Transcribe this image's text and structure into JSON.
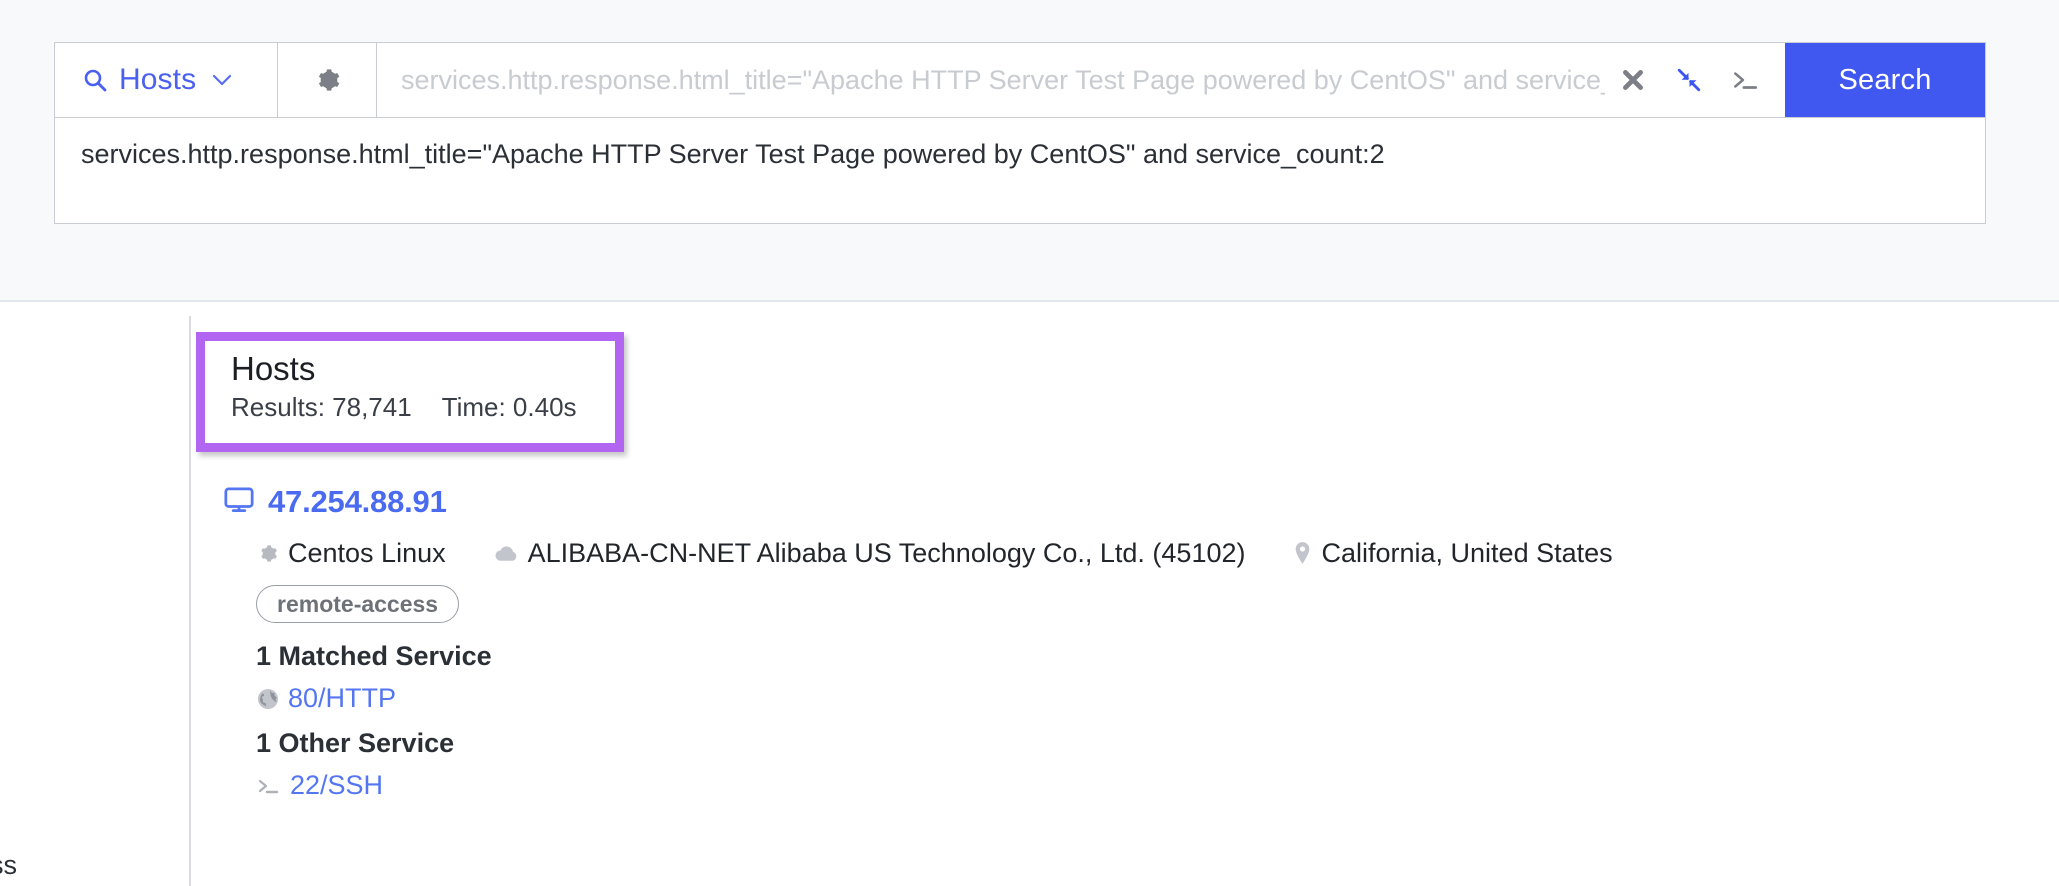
{
  "search": {
    "resource_type": "Hosts",
    "resource_icon": "search-icon",
    "settings_icon": "gear-icon",
    "query_value": "",
    "query_placeholder": "services.http.response.html_title=\"Apache HTTP Server Test Page powered by CentOS\" and service_count:2",
    "clear_icon": "close-x-icon",
    "collapse_icon": "collapse-arrows-icon",
    "console_icon": "terminal-prompt-icon",
    "submit_label": "Search",
    "suggestion": "services.http.response.html_title=\"Apache HTTP Server Test Page powered by CentOS\" and service_count:2",
    "accent_color": "#4057f0"
  },
  "results": {
    "facet_remnant_text": "ss",
    "summary": {
      "title": "Hosts",
      "results_label": "Results: 78,741",
      "time_label": "Time: 0.40s",
      "highlight_color": "#b265f0"
    },
    "hosts": [
      {
        "ip": "47.254.88.91",
        "host_icon": "monitor-icon",
        "os": "Centos Linux",
        "os_icon": "gear-icon",
        "network": "ALIBABA-CN-NET Alibaba US Technology Co., Ltd. (45102)",
        "network_icon": "cloud-icon",
        "location": "California, United States",
        "location_icon": "map-pin-icon",
        "tags": [
          "remote-access"
        ],
        "matched_services_heading": "1 Matched Service",
        "matched_services": [
          {
            "label": "80/HTTP",
            "icon": "globe-icon"
          }
        ],
        "other_services_heading": "1 Other Service",
        "other_services": [
          {
            "label": "22/SSH",
            "icon": "terminal-prompt-icon"
          }
        ]
      }
    ]
  }
}
